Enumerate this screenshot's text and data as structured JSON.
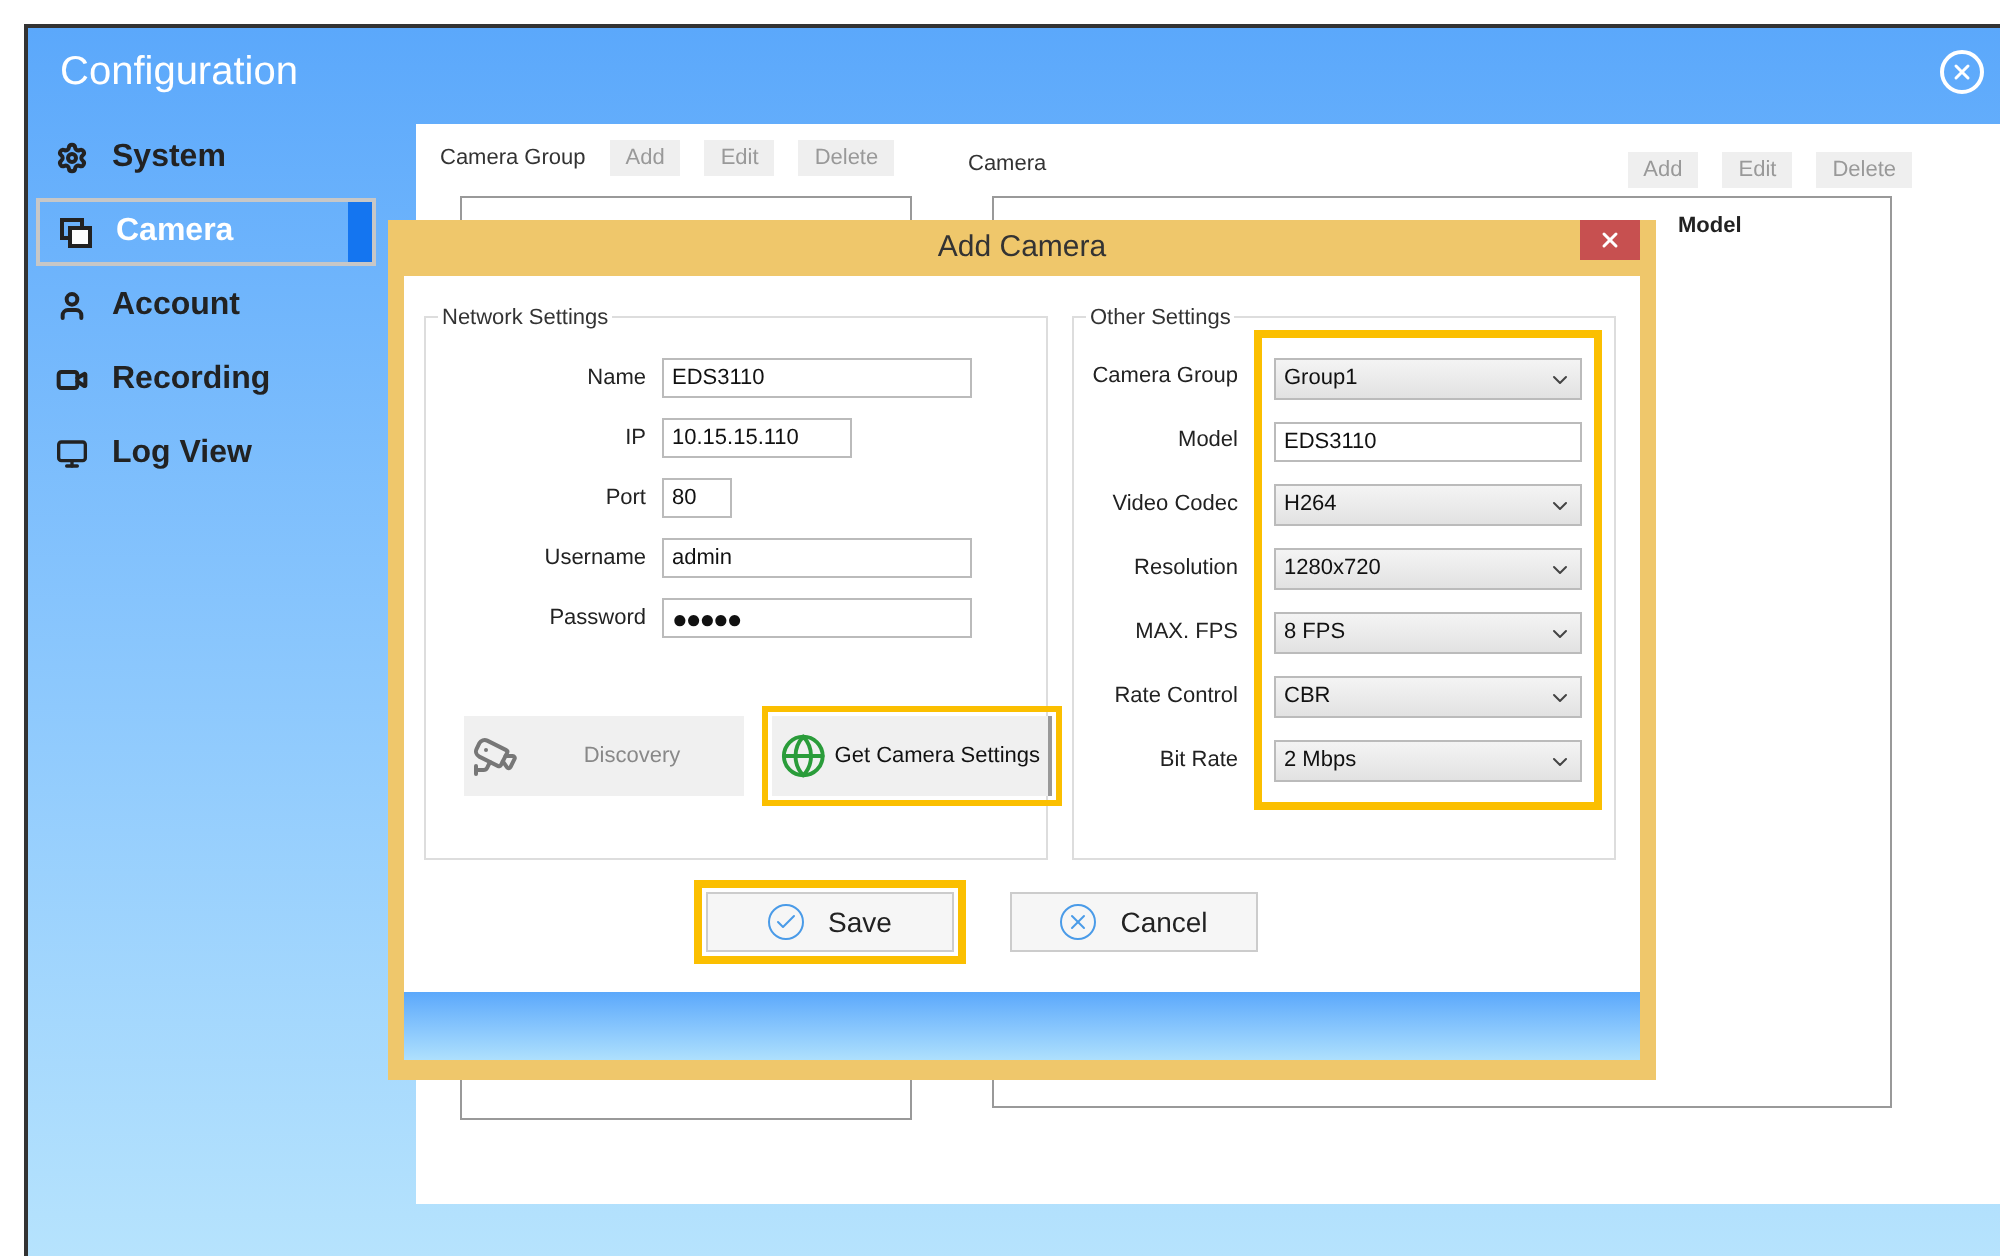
{
  "window": {
    "title": "Configuration"
  },
  "sidebar": {
    "items": [
      {
        "label": "System",
        "selected": false
      },
      {
        "label": "Camera",
        "selected": true
      },
      {
        "label": "Account",
        "selected": false
      },
      {
        "label": "Recording",
        "selected": false
      },
      {
        "label": "Log View",
        "selected": false
      }
    ]
  },
  "camera_group": {
    "title": "Camera Group",
    "buttons": [
      "Add",
      "Edit",
      "Delete"
    ]
  },
  "camera": {
    "title": "Camera",
    "buttons": [
      "Add",
      "Edit",
      "Delete"
    ],
    "columns": [
      "Model"
    ]
  },
  "dialog": {
    "title": "Add Camera",
    "network_settings": {
      "title": "Network Settings",
      "fields": [
        {
          "label": "Name",
          "kind": "text",
          "value": "EDS3110"
        },
        {
          "label": "IP",
          "kind": "text",
          "value": "10.15.15.110"
        },
        {
          "label": "Port",
          "kind": "text",
          "value": "80"
        },
        {
          "label": "Username",
          "kind": "text",
          "value": "admin"
        },
        {
          "label": "Password",
          "kind": "password",
          "value": "●●●●●"
        }
      ],
      "buttons": [
        {
          "label": "Discovery",
          "disabled": true,
          "highlighted": false
        },
        {
          "label": "Get Camera Settings",
          "disabled": false,
          "highlighted": true
        }
      ]
    },
    "other_settings": {
      "title": "Other Settings",
      "highlighted": true,
      "fields": [
        {
          "label": "Camera Group",
          "kind": "select",
          "value": "Group1"
        },
        {
          "label": "Model",
          "kind": "text",
          "value": "EDS3110"
        },
        {
          "label": "Video Codec",
          "kind": "select",
          "value": "H264"
        },
        {
          "label": "Resolution",
          "kind": "select",
          "value": "1280x720"
        },
        {
          "label": "MAX. FPS",
          "kind": "select",
          "value": "8 FPS"
        },
        {
          "label": "Rate Control",
          "kind": "select",
          "value": "CBR"
        },
        {
          "label": "Bit Rate",
          "kind": "select",
          "value": "2 Mbps"
        }
      ]
    },
    "actions": [
      {
        "label": "Save",
        "highlighted": true
      },
      {
        "label": "Cancel",
        "highlighted": false
      }
    ]
  }
}
